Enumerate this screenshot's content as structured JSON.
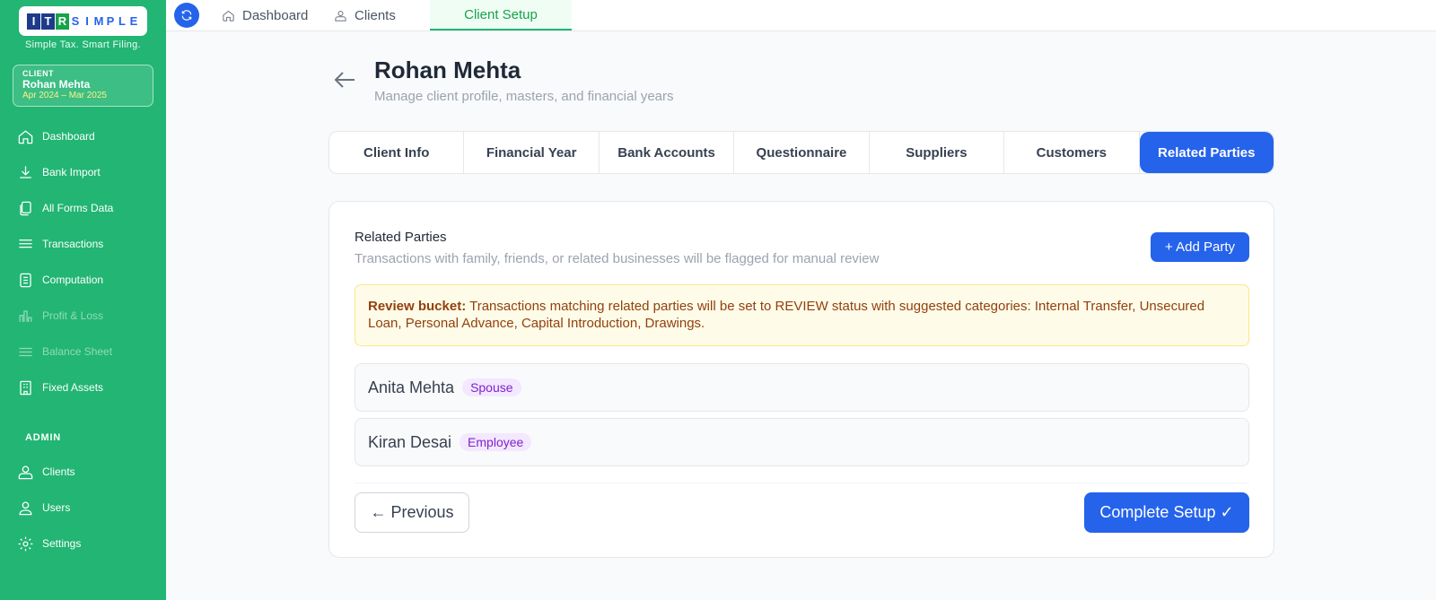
{
  "brand": {
    "logo_letters": [
      "I",
      "T",
      "R",
      "S",
      "I",
      "M",
      "P",
      "L",
      "E"
    ],
    "tagline": "Simple Tax. Smart Filing."
  },
  "client_card": {
    "label": "CLIENT",
    "name": "Rohan Mehta",
    "period": "Apr 2024 – Mar 2025"
  },
  "sidebar": {
    "items": [
      {
        "label": "Dashboard",
        "icon": "home-icon",
        "enabled": true
      },
      {
        "label": "Bank Import",
        "icon": "download-icon",
        "enabled": true
      },
      {
        "label": "All Forms Data",
        "icon": "documents-icon",
        "enabled": true
      },
      {
        "label": "Transactions",
        "icon": "list-icon",
        "enabled": true
      },
      {
        "label": "Computation",
        "icon": "calculator-icon",
        "enabled": true
      },
      {
        "label": "Profit & Loss",
        "icon": "bar-chart-icon",
        "enabled": false
      },
      {
        "label": "Balance Sheet",
        "icon": "list-icon",
        "enabled": false
      },
      {
        "label": "Fixed Assets",
        "icon": "building-icon",
        "enabled": true
      }
    ],
    "admin_label": "ADMIN",
    "admin_items": [
      {
        "label": "Clients",
        "icon": "clients-icon"
      },
      {
        "label": "Users",
        "icon": "users-icon"
      },
      {
        "label": "Settings",
        "icon": "gear-icon"
      }
    ]
  },
  "topbar": {
    "tabs": [
      {
        "label": "Dashboard",
        "icon": "home-icon"
      },
      {
        "label": "Clients",
        "icon": "clients-icon"
      },
      {
        "label": "Client Setup",
        "icon": ""
      }
    ],
    "active_tab": "Client Setup"
  },
  "header": {
    "title": "Rohan Mehta",
    "subtitle": "Manage client profile, masters, and financial years"
  },
  "steps": {
    "items": [
      "Client Info",
      "Financial Year",
      "Bank Accounts",
      "Questionnaire",
      "Suppliers",
      "Customers",
      "Related Parties"
    ],
    "active": "Related Parties"
  },
  "section": {
    "title": "Related Parties",
    "subtitle": "Transactions with family, friends, or related businesses will be flagged for manual review",
    "add_button": "+ Add Party",
    "notice_bold": "Review bucket:",
    "notice_text": " Transactions matching related parties will be set to REVIEW status with suggested categories: Internal Transfer, Unsecured Loan, Personal Advance, Capital Introduction, Drawings.",
    "parties": [
      {
        "name": "Anita Mehta",
        "relation": "Spouse"
      },
      {
        "name": "Kiran Desai",
        "relation": "Employee"
      }
    ],
    "previous_button": "← Previous",
    "complete_button": "Complete Setup ✓"
  },
  "colors": {
    "sidebar_bg": "#22b573",
    "primary": "#2563eb",
    "notice_bg": "#fefce8",
    "badge_text": "#7e22ce"
  }
}
